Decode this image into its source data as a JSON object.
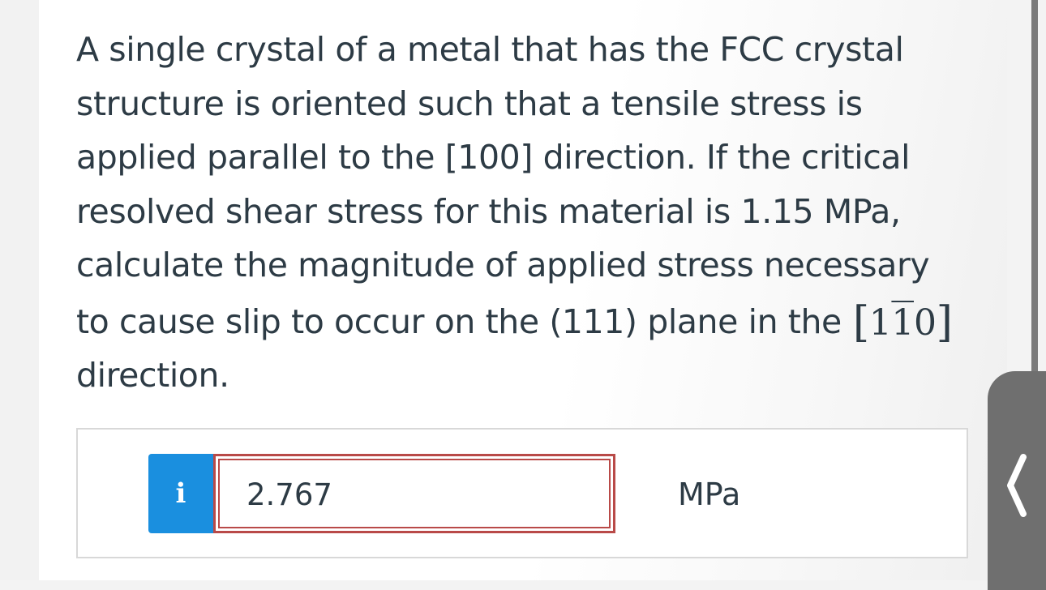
{
  "question": {
    "text": "A single crystal of a metal that has the FCC crystal structure is oriented such that a tensile stress is applied parallel to the [100] direction. If the critical resolved shear stress for this material is 1.15 MPa, calculate the magnitude of applied stress necessary to cause slip to occur on the (111) plane in the",
    "direction_vector": {
      "open_bracket": "[",
      "digit1": "1",
      "digit2_overbar": "1",
      "digit3": "0",
      "close_bracket": "]"
    },
    "trailing_text": "direction."
  },
  "answer": {
    "info_icon_glyph": "i",
    "value": "2.767",
    "units": "MPa",
    "status_color": "#b94a48"
  },
  "colors": {
    "info_button": "#1a8fdf",
    "text": "#2d3b45",
    "side_tab": "#6f6f6f"
  },
  "side_tab": {
    "icon": "chevron-left-icon"
  }
}
